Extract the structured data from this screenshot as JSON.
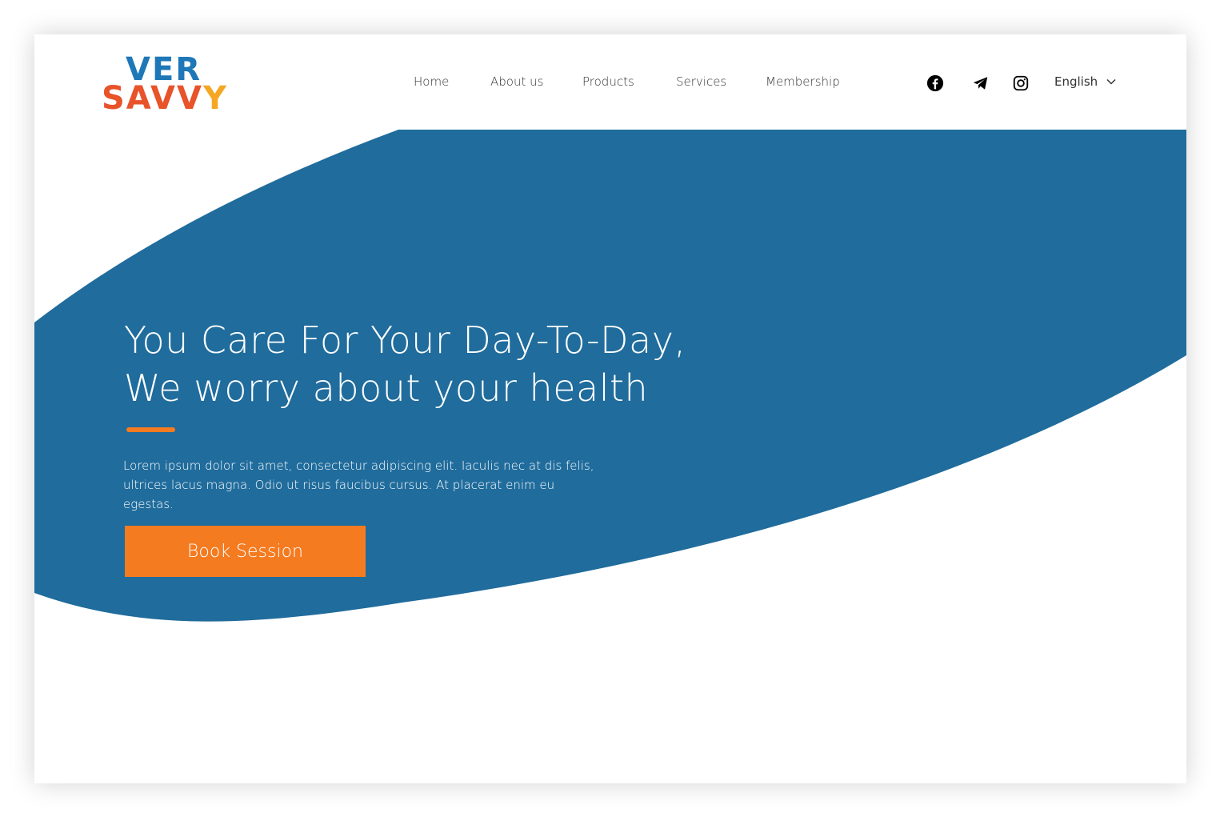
{
  "brand": {
    "logo_line1": "VER",
    "logo_line2_main": "SAVV",
    "logo_line2_accent": "Y",
    "colors": {
      "blue": "#1e78b8",
      "orange_red": "#e8532a",
      "yellow": "#f5a623"
    }
  },
  "nav": {
    "items": [
      {
        "label": "Home"
      },
      {
        "label": "About us"
      },
      {
        "label": "Products"
      },
      {
        "label": "Services"
      },
      {
        "label": "Membership"
      }
    ]
  },
  "social": [
    {
      "icon": "facebook-icon"
    },
    {
      "icon": "telegram-icon"
    },
    {
      "icon": "instagram-icon"
    }
  ],
  "language": {
    "selected": "English",
    "icon": "chevron-down-icon"
  },
  "hero": {
    "headline_line1": "You Care For Your Day-To-Day,",
    "headline_line2": "We worry about your health",
    "body": "Lorem ipsum dolor sit amet, consectetur adipiscing elit. Iaculis nec at dis felis, ultrices lacus magna. Odio ut risus faucibus cursus. At placerat enim eu egestas.",
    "cta_label": "Book Session"
  },
  "colors": {
    "hero_blue": "#206c9c",
    "accent_orange": "#f47b20",
    "text_dark": "#333333",
    "white": "#ffffff"
  }
}
